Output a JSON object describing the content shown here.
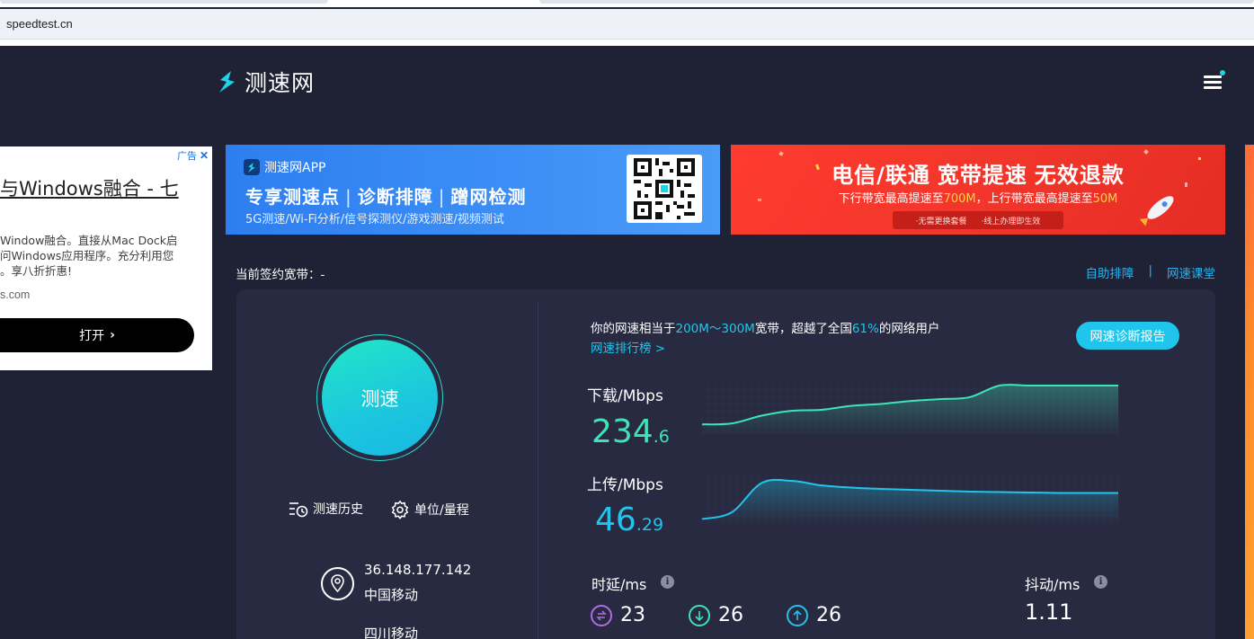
{
  "browser": {
    "url": "speedtest.cn"
  },
  "header": {
    "logo_text": "测速网",
    "menu_icon": "hamburger-icon"
  },
  "left_ad": {
    "ad_label": "广告",
    "title": "与Windows融合 - 七",
    "desc_lines": [
      "Window融合。直接从Mac Dock启",
      "问Windows应用程序。充分利用您",
      "。享八折折惠!"
    ],
    "domain": "s.com",
    "open_label": "打开"
  },
  "banner_app": {
    "app_name": "测速网APP",
    "headline": [
      "专享测速点",
      "诊断排障",
      "蹭网检测"
    ],
    "subtitle": "5G测速/Wi-Fi分析/信号探测仪/游戏测速/视频测试"
  },
  "banner_isp": {
    "title_parts": [
      "电信/联通",
      "宽带提速",
      "无效退款"
    ],
    "sub_prefix": "下行带宽最高提速至",
    "sub_down": "700M",
    "sub_mid": "，上行带宽最高提速至",
    "sub_up": "50M",
    "pill_items": [
      "·无需更换套餐",
      "·线上办理即生效"
    ]
  },
  "subscription": {
    "label": "当前签约宽带：",
    "value": "-"
  },
  "top_links": {
    "self_check": "自助排障",
    "divider": "|",
    "classroom": "网速课堂"
  },
  "go_button": {
    "label": "测速"
  },
  "tools": {
    "history": "测速历史",
    "units": "单位/量程"
  },
  "ip_info": {
    "address": "36.148.177.142",
    "isp": "中国移动",
    "region": "四川移动"
  },
  "summary": {
    "prefix": "你的网速相当于",
    "range": "200M～300M",
    "mid": "宽带，超越了全国",
    "percent": "61%",
    "suffix": "的网络用户",
    "rank_link": "网速排行榜 >",
    "report_button": "网速诊断报告"
  },
  "download": {
    "label": "下载/Mbps",
    "int": "234",
    "dec": ".6",
    "color": "#3fe3b8"
  },
  "upload": {
    "label": "上传/Mbps",
    "int": "46",
    "dec": ".29",
    "color": "#22c4ec"
  },
  "chart_data": [
    {
      "type": "area",
      "series": [
        {
          "values": [
            20,
            22,
            38,
            48,
            50,
            58,
            62,
            68,
            72,
            76,
            100,
            100,
            100,
            100,
            100
          ]
        }
      ],
      "ylim": [
        0,
        100
      ]
    },
    {
      "type": "area",
      "series": [
        {
          "values": [
            5,
            20,
            85,
            90,
            80,
            75,
            72,
            70,
            68,
            66,
            65,
            64,
            63,
            63,
            63
          ]
        }
      ],
      "ylim": [
        0,
        100
      ]
    }
  ],
  "latency": {
    "label": "时延/ms",
    "idle": "23",
    "download": "26",
    "upload": "26"
  },
  "jitter": {
    "label": "抖动/ms",
    "value": "1.11"
  },
  "colors": {
    "accent": "#22c6ea",
    "green": "#3fe3b8",
    "purple": "#b06be8",
    "bg": "#1f2235",
    "card": "#272a40"
  }
}
